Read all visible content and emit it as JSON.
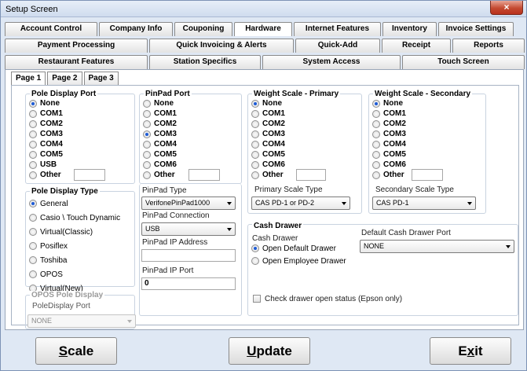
{
  "window": {
    "title": "Setup Screen",
    "close_glyph": "×"
  },
  "tabs_row1": [
    "Account Control",
    "Company Info",
    "Couponing",
    "Hardware",
    "Internet Features",
    "Inventory",
    "Invoice Settings"
  ],
  "tabs_row2": [
    "Payment Processing",
    "Quick Invoicing & Alerts",
    "Quick-Add",
    "Receipt",
    "Reports"
  ],
  "tabs_row3": [
    "Restaurant Features",
    "Station Specifics",
    "System Access",
    "Touch Screen"
  ],
  "subtabs": [
    "Page 1",
    "Page 2",
    "Page 3"
  ],
  "pole_display_port": {
    "title": "Pole Display Port",
    "options": [
      "None",
      "COM1",
      "COM2",
      "COM3",
      "COM4",
      "COM5",
      "USB",
      "Other"
    ],
    "selected": "None"
  },
  "pinpad_port": {
    "title": "PinPad Port",
    "options": [
      "None",
      "COM1",
      "COM2",
      "COM3",
      "COM4",
      "COM5",
      "COM6",
      "Other"
    ],
    "selected": "COM3"
  },
  "weight_scale_primary": {
    "title": "Weight Scale - Primary",
    "options": [
      "None",
      "COM1",
      "COM2",
      "COM3",
      "COM4",
      "COM5",
      "COM6",
      "Other"
    ],
    "selected": "None",
    "type_label": "Primary Scale Type",
    "type_value": "CAS PD-1 or PD-2"
  },
  "weight_scale_secondary": {
    "title": "Weight Scale - Secondary",
    "options": [
      "None",
      "COM1",
      "COM2",
      "COM3",
      "COM4",
      "COM5",
      "COM6",
      "Other"
    ],
    "selected": "None",
    "type_label": "Secondary Scale Type",
    "type_value": "CAS PD-1"
  },
  "pole_display_type": {
    "title": "Pole Display Type",
    "options": [
      "General",
      "Casio \\ Touch Dynamic",
      "Virtual(Classic)",
      "Posiflex",
      "Toshiba",
      "OPOS",
      "Virtual(New)"
    ],
    "selected": "General"
  },
  "pinpad": {
    "type_label": "PinPad Type",
    "type_value": "VerifonePinPad1000",
    "connection_label": "PinPad Connection",
    "connection_value": "USB",
    "ip_label": "PinPad IP Address",
    "ip_value": "",
    "port_label": "PinPad IP Port",
    "port_value": "0"
  },
  "opos_pole_display": {
    "title": "OPOS Pole Display",
    "port_label": "PoleDisplay Port",
    "port_value": "NONE"
  },
  "cash_drawer": {
    "title": "Cash Drawer",
    "drawer_label": "Cash Drawer",
    "options": [
      "Open Default Drawer",
      "Open Employee Drawer"
    ],
    "selected": "Open Default Drawer",
    "default_port_label": "Default Cash Drawer Port",
    "default_port_value": "NONE",
    "check_label": "Check drawer open status (Epson only)"
  },
  "buttons": {
    "scale": {
      "first": "S",
      "rest": "cale"
    },
    "update": {
      "first": "U",
      "rest": "pdate"
    },
    "exit": {
      "first": "E",
      "mid": "x",
      "rest": "it"
    }
  }
}
